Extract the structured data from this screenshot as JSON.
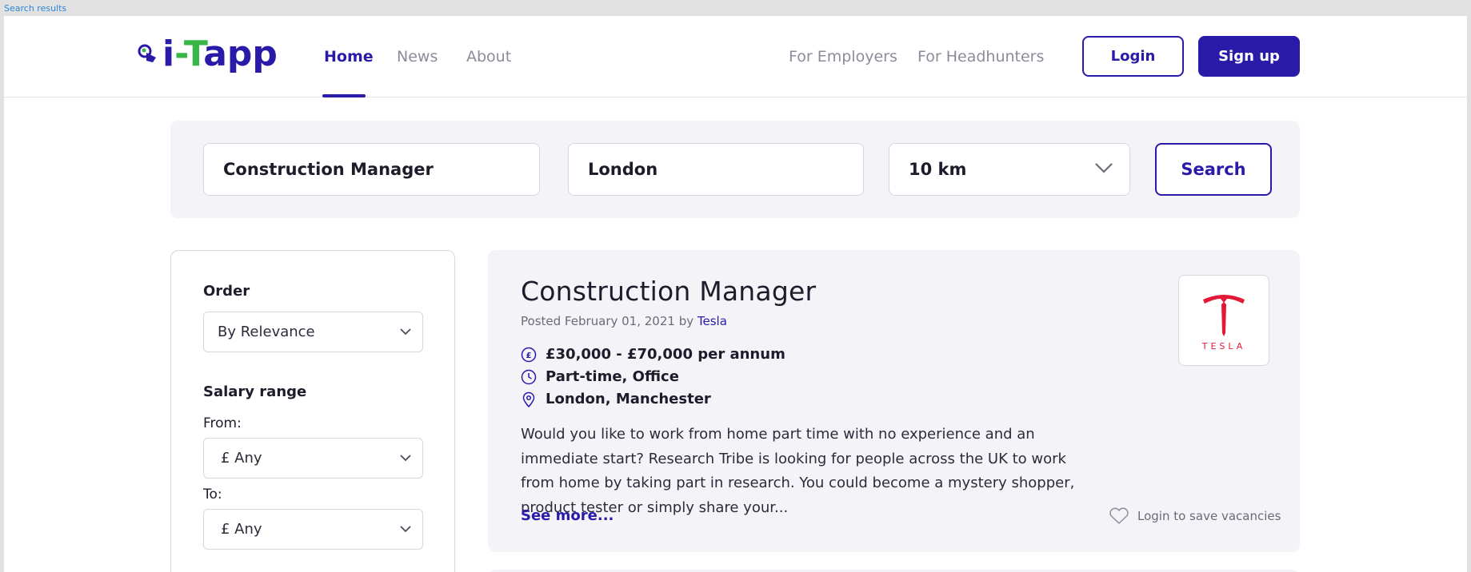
{
  "frame": {
    "label": "Search results"
  },
  "header": {
    "logo_text_i": "i",
    "logo_text_dash": "-",
    "logo_text_t": "T",
    "logo_text_rest": "app",
    "nav": [
      {
        "label": "Home",
        "active": true
      },
      {
        "label": "News",
        "active": false
      },
      {
        "label": "About",
        "active": false
      }
    ],
    "secondary_nav": [
      {
        "label": "For Employers"
      },
      {
        "label": "For Headhunters"
      }
    ],
    "login_label": "Login",
    "signup_label": "Sign up"
  },
  "search": {
    "keyword": "Construction Manager",
    "location": "London",
    "radius": "10 km",
    "button_label": "Search"
  },
  "filters": {
    "order_heading": "Order",
    "order_value": "By Relevance",
    "salary_heading": "Salary range",
    "from_label": "From:",
    "from_value": "£ Any",
    "to_label": "To:",
    "to_value": "£ Any"
  },
  "job": {
    "title": "Construction Manager",
    "posted_prefix": "Posted February 01, 2021 by ",
    "company": "Tesla",
    "salary": "£30,000 - £70,000 per annum",
    "type": "Part-time, Office",
    "location": "London, Manchester",
    "description": "Would you like to work from home part time with no experience and an immediate start? Research Tribe is looking for people across the UK to work from home by taking part in research. You could become a mystery shopper, product tester or simply share your...",
    "see_more": "See more...",
    "save_label": "Login to save vacancies",
    "logo_text": "TESLA"
  },
  "colors": {
    "brand": "#2a1aa8",
    "accent_green": "#39b54a",
    "panel_bg": "#f3f3f8",
    "tesla_red": "#e31937"
  }
}
